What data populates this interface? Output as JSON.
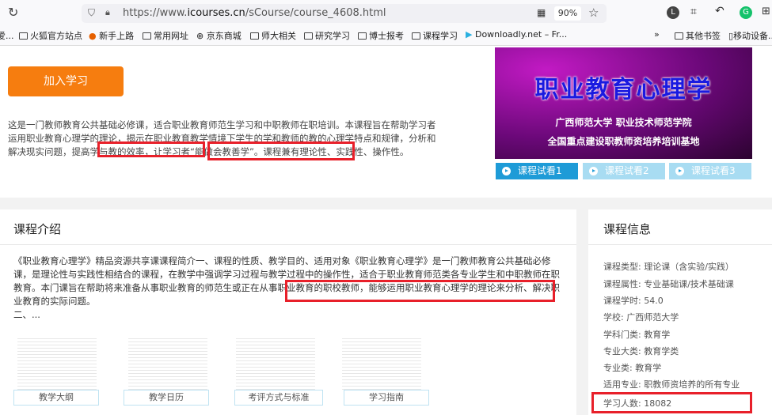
{
  "browser": {
    "url_prefix": "https://www.",
    "url_domain": "icourses.cn",
    "url_path": "/sCourse/course_4608.html",
    "zoom": "90%",
    "bookmarks": [
      "爱...",
      "火狐官方站点",
      "新手上路",
      "常用网址",
      "京东商城",
      "师大相关",
      "研究学习",
      "博士报考",
      "课程学习",
      "Downloadly.net – Fr..."
    ],
    "bookmarks_right": [
      "其他书签",
      "移动设备..."
    ]
  },
  "course": {
    "join_label": "加入学习",
    "desc_before": "这是一门教师教育公共基础必修课，适合职业教育师范生学习和中职教师在职培训。本课程旨在帮助学习者运用职业教育心理学的理论，揭示在职业教育教学情境下学生的学和教师的教的心理学特点和规律，分析和解决现实问题，提高学与教的效率，",
    "desc_hl1": "让学习者“能做会教善学”",
    "desc_sep": "。",
    "desc_hl2": "课程兼有理论性、实践性、操作性。",
    "banner_title": "职业教育心理学",
    "banner_line1": "广西师范大学 职业技术师范学院",
    "banner_line2": "全国重点建设职教师资培养培训基地",
    "trials": [
      "课程试看1",
      "课程试看2",
      "课程试看3"
    ]
  },
  "intro": {
    "heading": "课程介绍",
    "text_before": "《职业教育心理学》精品资源共享课课程简介一、课程的性质、教学目的、适用对象《职业教育心理学》是一门教师教育公共基础必修课，是理论性与实践性相结合的课程，在教学中强调学习过程与教学过程中的操作性，适合于职业教育师范类各专业学生和中职教师在职教育。本门课旨在帮助将来准备从事职业教育的师范生或正在从事职业教育的职校教师，",
    "text_hl": "能够运用职业教育心理学的理论来分析、解决职业教育的实际问题。",
    "text_after": "二、...",
    "docs": [
      "教学大纲",
      "教学日历",
      "考评方式与标准",
      "学习指南"
    ]
  },
  "info": {
    "heading": "课程信息",
    "rows": [
      "课程类型: 理论课（含实验/实践）",
      "课程属性: 专业基础课/技术基础课",
      "课程学时: 54.0",
      "学校: 广西师范大学",
      "学科门类: 教育学",
      "专业大类: 教育学类",
      "专业类: 教育学",
      "适用专业: 职教师资培养的所有专业",
      "学习人数: 18082"
    ]
  },
  "colors": {
    "accent": "#f67d0f",
    "trial_active": "#1e9bd7",
    "trial_inactive": "#a8dcf2",
    "highlight": "#e8202a"
  }
}
